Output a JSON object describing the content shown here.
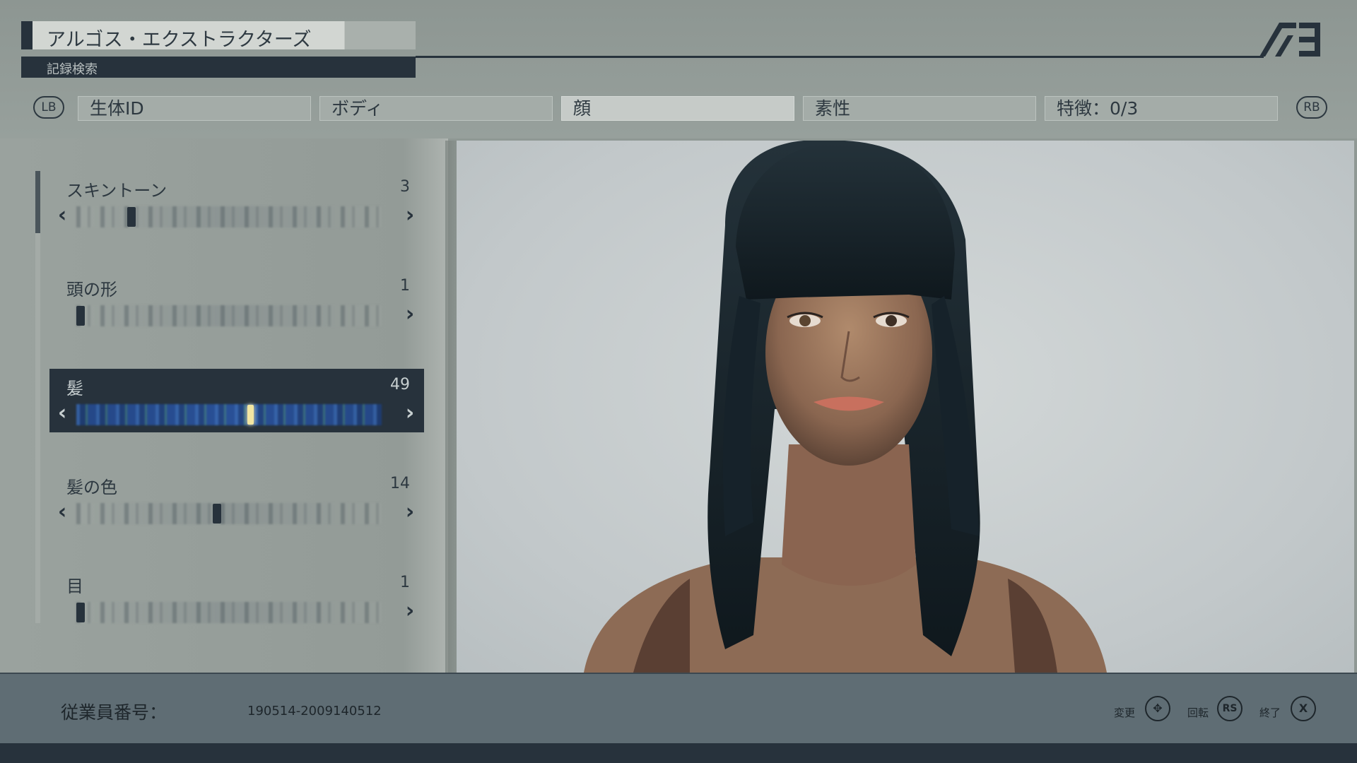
{
  "header": {
    "title": "アルゴス・エクストラクターズ",
    "subtitle": "記録検索",
    "logo_icon": "ae-logo-icon"
  },
  "bumpers": {
    "left": "LB",
    "right": "RB"
  },
  "tabs": [
    {
      "label": "生体ID",
      "active": false
    },
    {
      "label": "ボディ",
      "active": false
    },
    {
      "label": "顔",
      "active": true
    },
    {
      "label": "素性",
      "active": false
    },
    {
      "label": "特徴：0/3",
      "active": false
    }
  ],
  "options": [
    {
      "label": "スキントーン",
      "value": "3",
      "level": 0.18,
      "selected": false,
      "has_left_arrow": true
    },
    {
      "label": "頭の形",
      "value": "1",
      "level": 0.0,
      "selected": false,
      "has_left_arrow": false
    },
    {
      "label": "髪",
      "value": "49",
      "level": 0.57,
      "selected": true,
      "has_left_arrow": true
    },
    {
      "label": "髪の色",
      "value": "14",
      "level": 0.46,
      "selected": false,
      "has_left_arrow": true
    },
    {
      "label": "目",
      "value": "1",
      "level": 0.0,
      "selected": false,
      "has_left_arrow": false
    }
  ],
  "footer": {
    "employee_label": "従業員番号：",
    "employee_number": "190514-2009140512",
    "hints": [
      {
        "label": "変更",
        "button": "✥",
        "icon": "dpad-icon"
      },
      {
        "label": "回転",
        "button": "RS",
        "icon": "rs-stick-icon"
      },
      {
        "label": "終了",
        "button": "X",
        "icon": "x-button-icon"
      }
    ]
  },
  "colors": {
    "panel_dark": "#27323c",
    "background": "#8f9894",
    "highlight_marker": "#f2e6a2"
  }
}
